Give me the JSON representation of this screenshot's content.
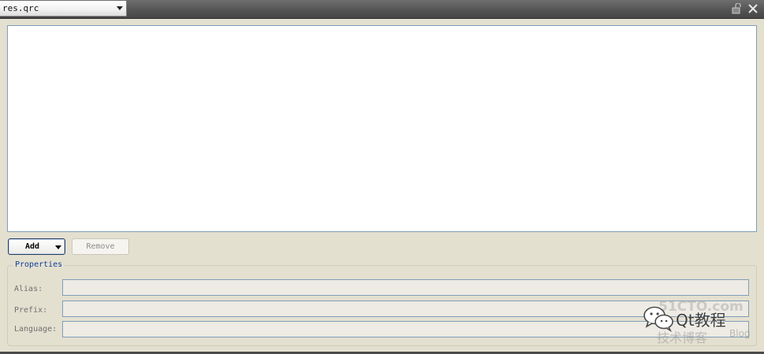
{
  "title_bar": {
    "file_selector_value": "res.qrc",
    "lock_icon": "lock-icon",
    "close_icon": "close-icon"
  },
  "actions": {
    "add_label": "Add",
    "remove_label": "Remove"
  },
  "properties": {
    "group_title": "Properties",
    "fields": [
      {
        "label": "Alias:",
        "value": ""
      },
      {
        "label": "Prefix:",
        "value": ""
      },
      {
        "label": "Language:",
        "value": ""
      }
    ]
  },
  "watermark": {
    "main_text": "Qt教程",
    "background_text_1": "51CTO.com",
    "background_text_2": "技术博客",
    "background_text_3": "Blog"
  },
  "colors": {
    "background": "#e4e0d0",
    "titlebar": "#595959",
    "accent_title": "#0e3e9c",
    "input_border": "#7f9db9"
  }
}
